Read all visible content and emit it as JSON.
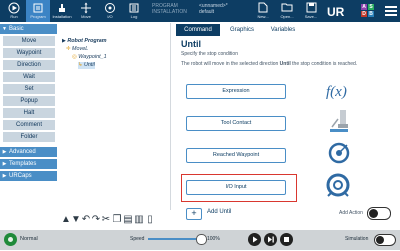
{
  "topbar": {
    "buttons": [
      {
        "label": "Run",
        "icon": "run-icon"
      },
      {
        "label": "Program",
        "icon": "program-icon"
      },
      {
        "label": "Installation",
        "icon": "installation-icon"
      },
      {
        "label": "Move",
        "icon": "move-icon"
      },
      {
        "label": "I/O",
        "icon": "io-icon"
      },
      {
        "label": "Log",
        "icon": "log-icon"
      }
    ],
    "program_key": "PROGRAM",
    "program_val": "<unnamed>*",
    "installation_key": "INSTALLATION",
    "installation_val": "default",
    "right_buttons": [
      {
        "label": "New...",
        "icon": "new-file-icon"
      },
      {
        "label": "Open...",
        "icon": "open-folder-icon"
      },
      {
        "label": "Save...",
        "icon": "save-icon"
      }
    ],
    "mode_letters": [
      "A",
      "S",
      "D",
      "B"
    ],
    "mode_colors": [
      "#8e44ad",
      "#27ae60",
      "#c0392b",
      "#2980b9"
    ]
  },
  "leftnav": {
    "basic": "Basic",
    "items": [
      "Move",
      "Waypoint",
      "Direction",
      "Wait",
      "Set",
      "Popup",
      "Halt",
      "Comment",
      "Folder"
    ],
    "advanced": "Advanced",
    "templates": "Templates",
    "urcaps": "URCaps"
  },
  "tree": {
    "robot_program": "Robot Program",
    "movel": "MoveL",
    "waypoint": "Waypoint_1",
    "until": "Until"
  },
  "tabs": [
    "Command",
    "Graphics",
    "Variables"
  ],
  "content": {
    "title": "Until",
    "subtitle": "Specify the stop condition",
    "description_pre": "The robot will move in the selected direction ",
    "description_bold": "Until",
    "description_post": " the stop condition is reached.",
    "buttons": [
      "Expression",
      "Tool Contact",
      "Reached Waypoint",
      "I/O Input"
    ],
    "add_until": "Add Until",
    "add_action": "Add Action"
  },
  "bottombar": {
    "status": "Normal",
    "speed_label": "Speed",
    "speed_value": "100%",
    "speed_fraction": 1.0,
    "simulation_label": "Simulation"
  }
}
